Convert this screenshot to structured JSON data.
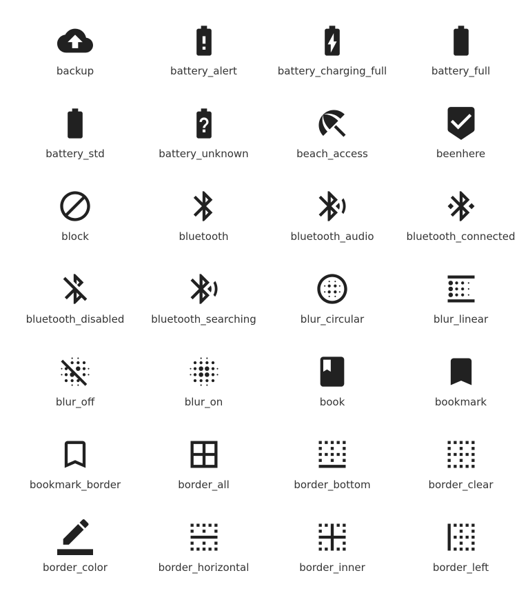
{
  "accent": "#212121",
  "icons": [
    {
      "label": "backup",
      "icon": "backup-icon"
    },
    {
      "label": "battery_alert",
      "icon": "battery-alert-icon"
    },
    {
      "label": "battery_charging_full",
      "icon": "battery-charging-full-icon"
    },
    {
      "label": "battery_full",
      "icon": "battery-full-icon"
    },
    {
      "label": "battery_std",
      "icon": "battery-std-icon"
    },
    {
      "label": "battery_unknown",
      "icon": "battery-unknown-icon"
    },
    {
      "label": "beach_access",
      "icon": "beach-access-icon"
    },
    {
      "label": "beenhere",
      "icon": "beenhere-icon"
    },
    {
      "label": "block",
      "icon": "block-icon"
    },
    {
      "label": "bluetooth",
      "icon": "bluetooth-icon"
    },
    {
      "label": "bluetooth_audio",
      "icon": "bluetooth-audio-icon"
    },
    {
      "label": "bluetooth_connected",
      "icon": "bluetooth-connected-icon"
    },
    {
      "label": "bluetooth_disabled",
      "icon": "bluetooth-disabled-icon"
    },
    {
      "label": "bluetooth_searching",
      "icon": "bluetooth-searching-icon"
    },
    {
      "label": "blur_circular",
      "icon": "blur-circular-icon"
    },
    {
      "label": "blur_linear",
      "icon": "blur-linear-icon"
    },
    {
      "label": "blur_off",
      "icon": "blur-off-icon"
    },
    {
      "label": "blur_on",
      "icon": "blur-on-icon"
    },
    {
      "label": "book",
      "icon": "book-icon"
    },
    {
      "label": "bookmark",
      "icon": "bookmark-icon"
    },
    {
      "label": "bookmark_border",
      "icon": "bookmark-border-icon"
    },
    {
      "label": "border_all",
      "icon": "border-all-icon"
    },
    {
      "label": "border_bottom",
      "icon": "border-bottom-icon"
    },
    {
      "label": "border_clear",
      "icon": "border-clear-icon"
    },
    {
      "label": "border_color",
      "icon": "border-color-icon"
    },
    {
      "label": "border_horizontal",
      "icon": "border-horizontal-icon"
    },
    {
      "label": "border_inner",
      "icon": "border-inner-icon"
    },
    {
      "label": "border_left",
      "icon": "border-left-icon"
    }
  ]
}
